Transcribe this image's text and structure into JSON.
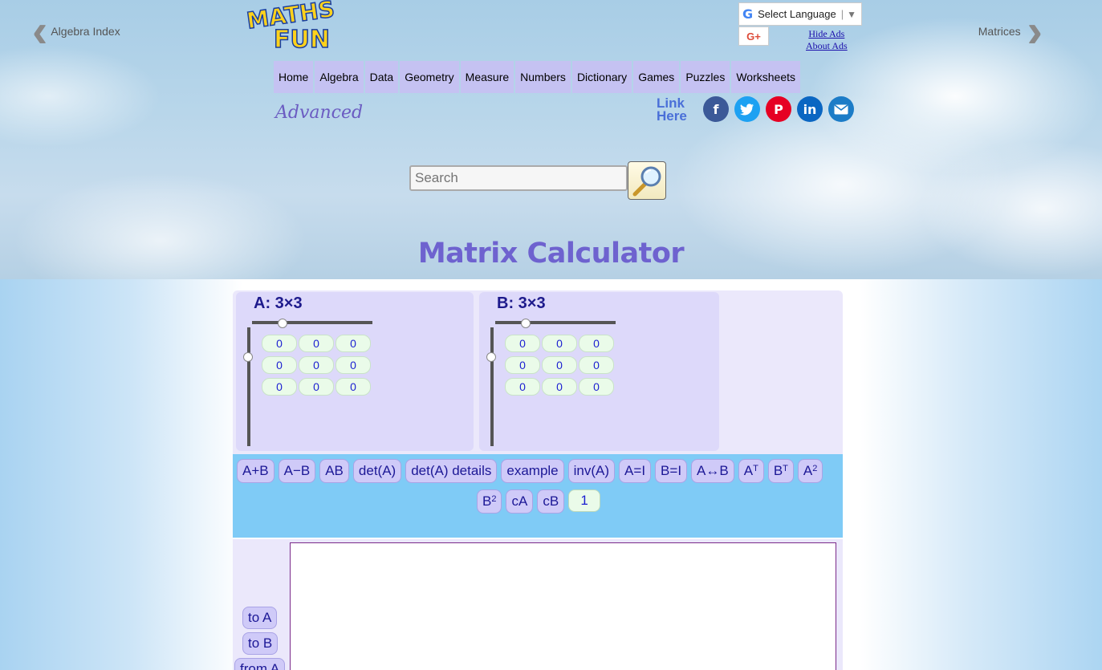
{
  "nav": {
    "prev_label": "Algebra Index",
    "next_label": "Matrices"
  },
  "logo": {
    "line1": "MATHS",
    "line2": "FUN"
  },
  "language": {
    "label": "Select Language"
  },
  "gplus_label": "G+",
  "ads": {
    "hide": "Hide Ads",
    "about": "About Ads"
  },
  "menu": [
    "Home",
    "Algebra",
    "Data",
    "Geometry",
    "Measure",
    "Numbers",
    "Dictionary",
    "Games",
    "Puzzles",
    "Worksheets"
  ],
  "level": "Advanced",
  "link_here": {
    "line1": "Link",
    "line2": "Here"
  },
  "social": [
    "facebook-icon",
    "twitter-icon",
    "pinterest-icon",
    "linkedin-icon",
    "email-icon"
  ],
  "search": {
    "placeholder": "Search"
  },
  "page_title": "Matrix Calculator",
  "matrix_a": {
    "title": "A: 3×3",
    "cells": [
      "0",
      "0",
      "0",
      "0",
      "0",
      "0",
      "0",
      "0",
      "0"
    ]
  },
  "matrix_b": {
    "title": "B: 3×3",
    "cells": [
      "0",
      "0",
      "0",
      "0",
      "0",
      "0",
      "0",
      "0",
      "0"
    ]
  },
  "operations": {
    "row1": [
      "A+B",
      "A−B",
      "AB",
      "det(A)",
      "det(A) details",
      "example",
      "inv(A)",
      "A=I",
      "B=I",
      "A↔B"
    ],
    "transpose_a": {
      "base": "A",
      "sup": "T"
    },
    "transpose_b": {
      "base": "B",
      "sup": "T"
    },
    "square_a": {
      "base": "A",
      "sup": "2"
    },
    "square_b": {
      "base": "B",
      "sup": "2"
    },
    "scale_a": "cA",
    "scale_b": "cB",
    "scalar_value": "1"
  },
  "side_buttons": {
    "to_a": "to A",
    "to_b": "to B",
    "from_a": "from A"
  },
  "colors": {
    "menu_bg": "#c5c2f2",
    "title": "#6e62cf",
    "ops_bg": "#7fcbf6",
    "button_bg": "#cfcaf8",
    "cell_bg": "#eafbe9"
  }
}
